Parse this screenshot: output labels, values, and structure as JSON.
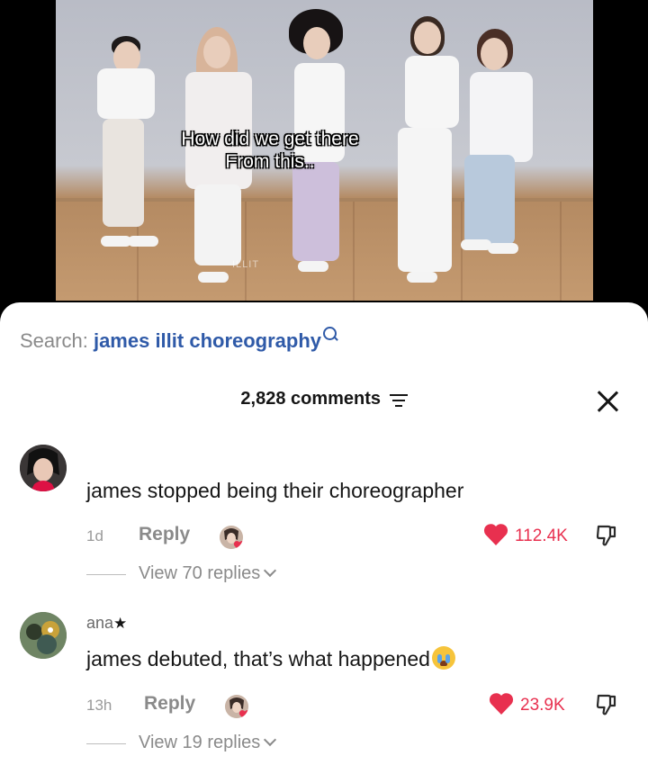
{
  "video": {
    "caption_line1": "How did we get there",
    "caption_line2": "From this..",
    "watermark": "ILLIT"
  },
  "search": {
    "label": "Search:",
    "query": "james illit choreography",
    "icon": "search-icon"
  },
  "comments_header": {
    "count_text": "2,828 comments",
    "filter_icon": "filter-icon",
    "close_icon": "close-icon"
  },
  "comments": [
    {
      "username": "",
      "text": "james stopped being their choreographer",
      "time": "1d",
      "reply_label": "Reply",
      "likes": "112.4K",
      "view_replies": "View 70 replies"
    },
    {
      "username": "ana",
      "text": "james debuted, that’s what happened",
      "time": "13h",
      "reply_label": "Reply",
      "likes": "23.9K",
      "view_replies": "View 19 replies"
    }
  ],
  "colors": {
    "like_red": "#e8304f",
    "search_blue": "#2f5aa8"
  }
}
